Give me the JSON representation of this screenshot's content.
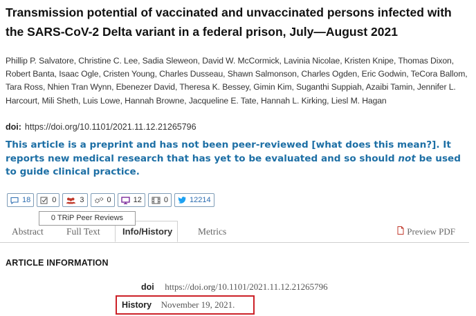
{
  "article": {
    "title": "Transmission potential of vaccinated and unvaccinated persons infected with the SARS-CoV-2 Delta variant in a federal prison, July—August 2021",
    "authors": "Phillip P. Salvatore, Christine C. Lee, Sadia Sleweon, David W. McCormick, Lavinia Nicolae, Kristen Knipe, Thomas Dixon, Robert Banta, Isaac Ogle, Cristen Young, Charles Dusseau, Shawn Salmonson, Charles Ogden, Eric Godwin, TeCora Ballom, Tara Ross, Nhien Tran Wynn, Ebenezer David, Theresa K. Bessey, Gimin Kim, Suganthi Suppiah, Azaibi Tamin, Jennifer L. Harcourt, Mili Sheth, Luis Lowe, Hannah Browne, Jacqueline E. Tate, Hannah L. Kirking, Liesl M. Hagan",
    "doi_label": "doi:",
    "doi_value": "https://doi.org/10.1101/2021.11.12.21265796"
  },
  "notice": {
    "part1": "This article is a preprint and has not been peer-reviewed [what does this mean?]. It reports new medical research that has yet to be evaluated and so should ",
    "emphasis": "not",
    "part2": " be used to guide clinical practice."
  },
  "metrics": [
    {
      "icon": "comment-icon",
      "count": "18"
    },
    {
      "icon": "checkbox-icon",
      "count": "0"
    },
    {
      "icon": "people-icon",
      "count": "3"
    },
    {
      "icon": "gears-icon",
      "count": "0"
    },
    {
      "icon": "monitor-icon",
      "count": "12"
    },
    {
      "icon": "film-icon",
      "count": "0"
    },
    {
      "icon": "twitter-icon",
      "count": "12214"
    }
  ],
  "tooltip": "0 TRiP Peer Reviews",
  "tabs": {
    "abstract": "Abstract",
    "full_text": "Full Text",
    "info_history": "Info/History",
    "metrics": "Metrics",
    "preview_pdf": "Preview PDF"
  },
  "info": {
    "heading": "ARTICLE INFORMATION",
    "doi_label": "doi",
    "doi_value": "https://doi.org/10.1101/2021.11.12.21265796",
    "history_label": "History",
    "history_value": "November 19, 2021."
  },
  "colors": {
    "notice_blue": "#1d6fa5",
    "highlight_red": "#cc2027",
    "people_red": "#c0392b",
    "monitor_purple": "#7b2a9b"
  }
}
